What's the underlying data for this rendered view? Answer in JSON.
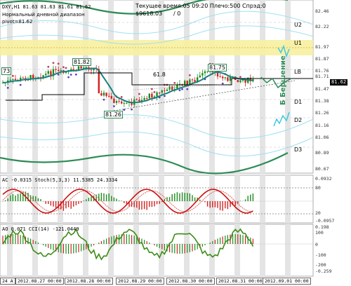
{
  "header": {
    "symbol_line": "DXY,H1  81.63 81.63 81.61 81.62",
    "range_label": "Нормальный дневной диапазон",
    "pivot_label": "pivot=81.62",
    "server_time": "Текущее время:05 09:20 Плечо:500 Спрэд:0",
    "balance": "$9618.03",
    "slash_zero": "/ 0"
  },
  "levels": {
    "u2": "U2",
    "u1": "U1",
    "lb": "LB",
    "d1": "D1",
    "d2": "D2",
    "d3": "D3"
  },
  "price_axis": [
    "82.46",
    "82.22",
    "81.97",
    "81.87",
    "81.76",
    "81.71",
    "81.62",
    "81.47",
    "81.38",
    "81.26",
    "81.16",
    "81.06",
    "80.89",
    "80.67"
  ],
  "current_price": "81.62",
  "annotations": {
    "left_tag": "73",
    "tag_8182": "81.82",
    "tag_618": "61.8",
    "tag_8175": "81.75",
    "tag_8126": "81.26",
    "vertical_text": "Б Бершение"
  },
  "ac_panel": {
    "label": "AC -0.0315  Stoch(5,3,3) 11.5385 24.3334",
    "axis": [
      "0.0932",
      "80",
      "20",
      "-0.0957"
    ]
  },
  "ao_panel": {
    "label": "AO 0.071  CCI(14) -121.0449",
    "axis": [
      "0.198",
      "100",
      "0",
      "-100",
      "-200",
      "-0.259"
    ]
  },
  "time_axis": [
    "24 A",
    "2012.08.27 00:00",
    "2012.08.28 00:00",
    "2012.08.29 00:00",
    "2012.08.30 00:00",
    "2012.08.31 00:00",
    "2012.09.01 00:00"
  ],
  "colors": {
    "bull": "#1e8c1e",
    "bear": "#d22020",
    "band_green": "#2e8b57",
    "band_cyan": "#9fe0f0",
    "pivot_zone": "#f7f0a0",
    "grid": "#c8c8c8"
  }
}
